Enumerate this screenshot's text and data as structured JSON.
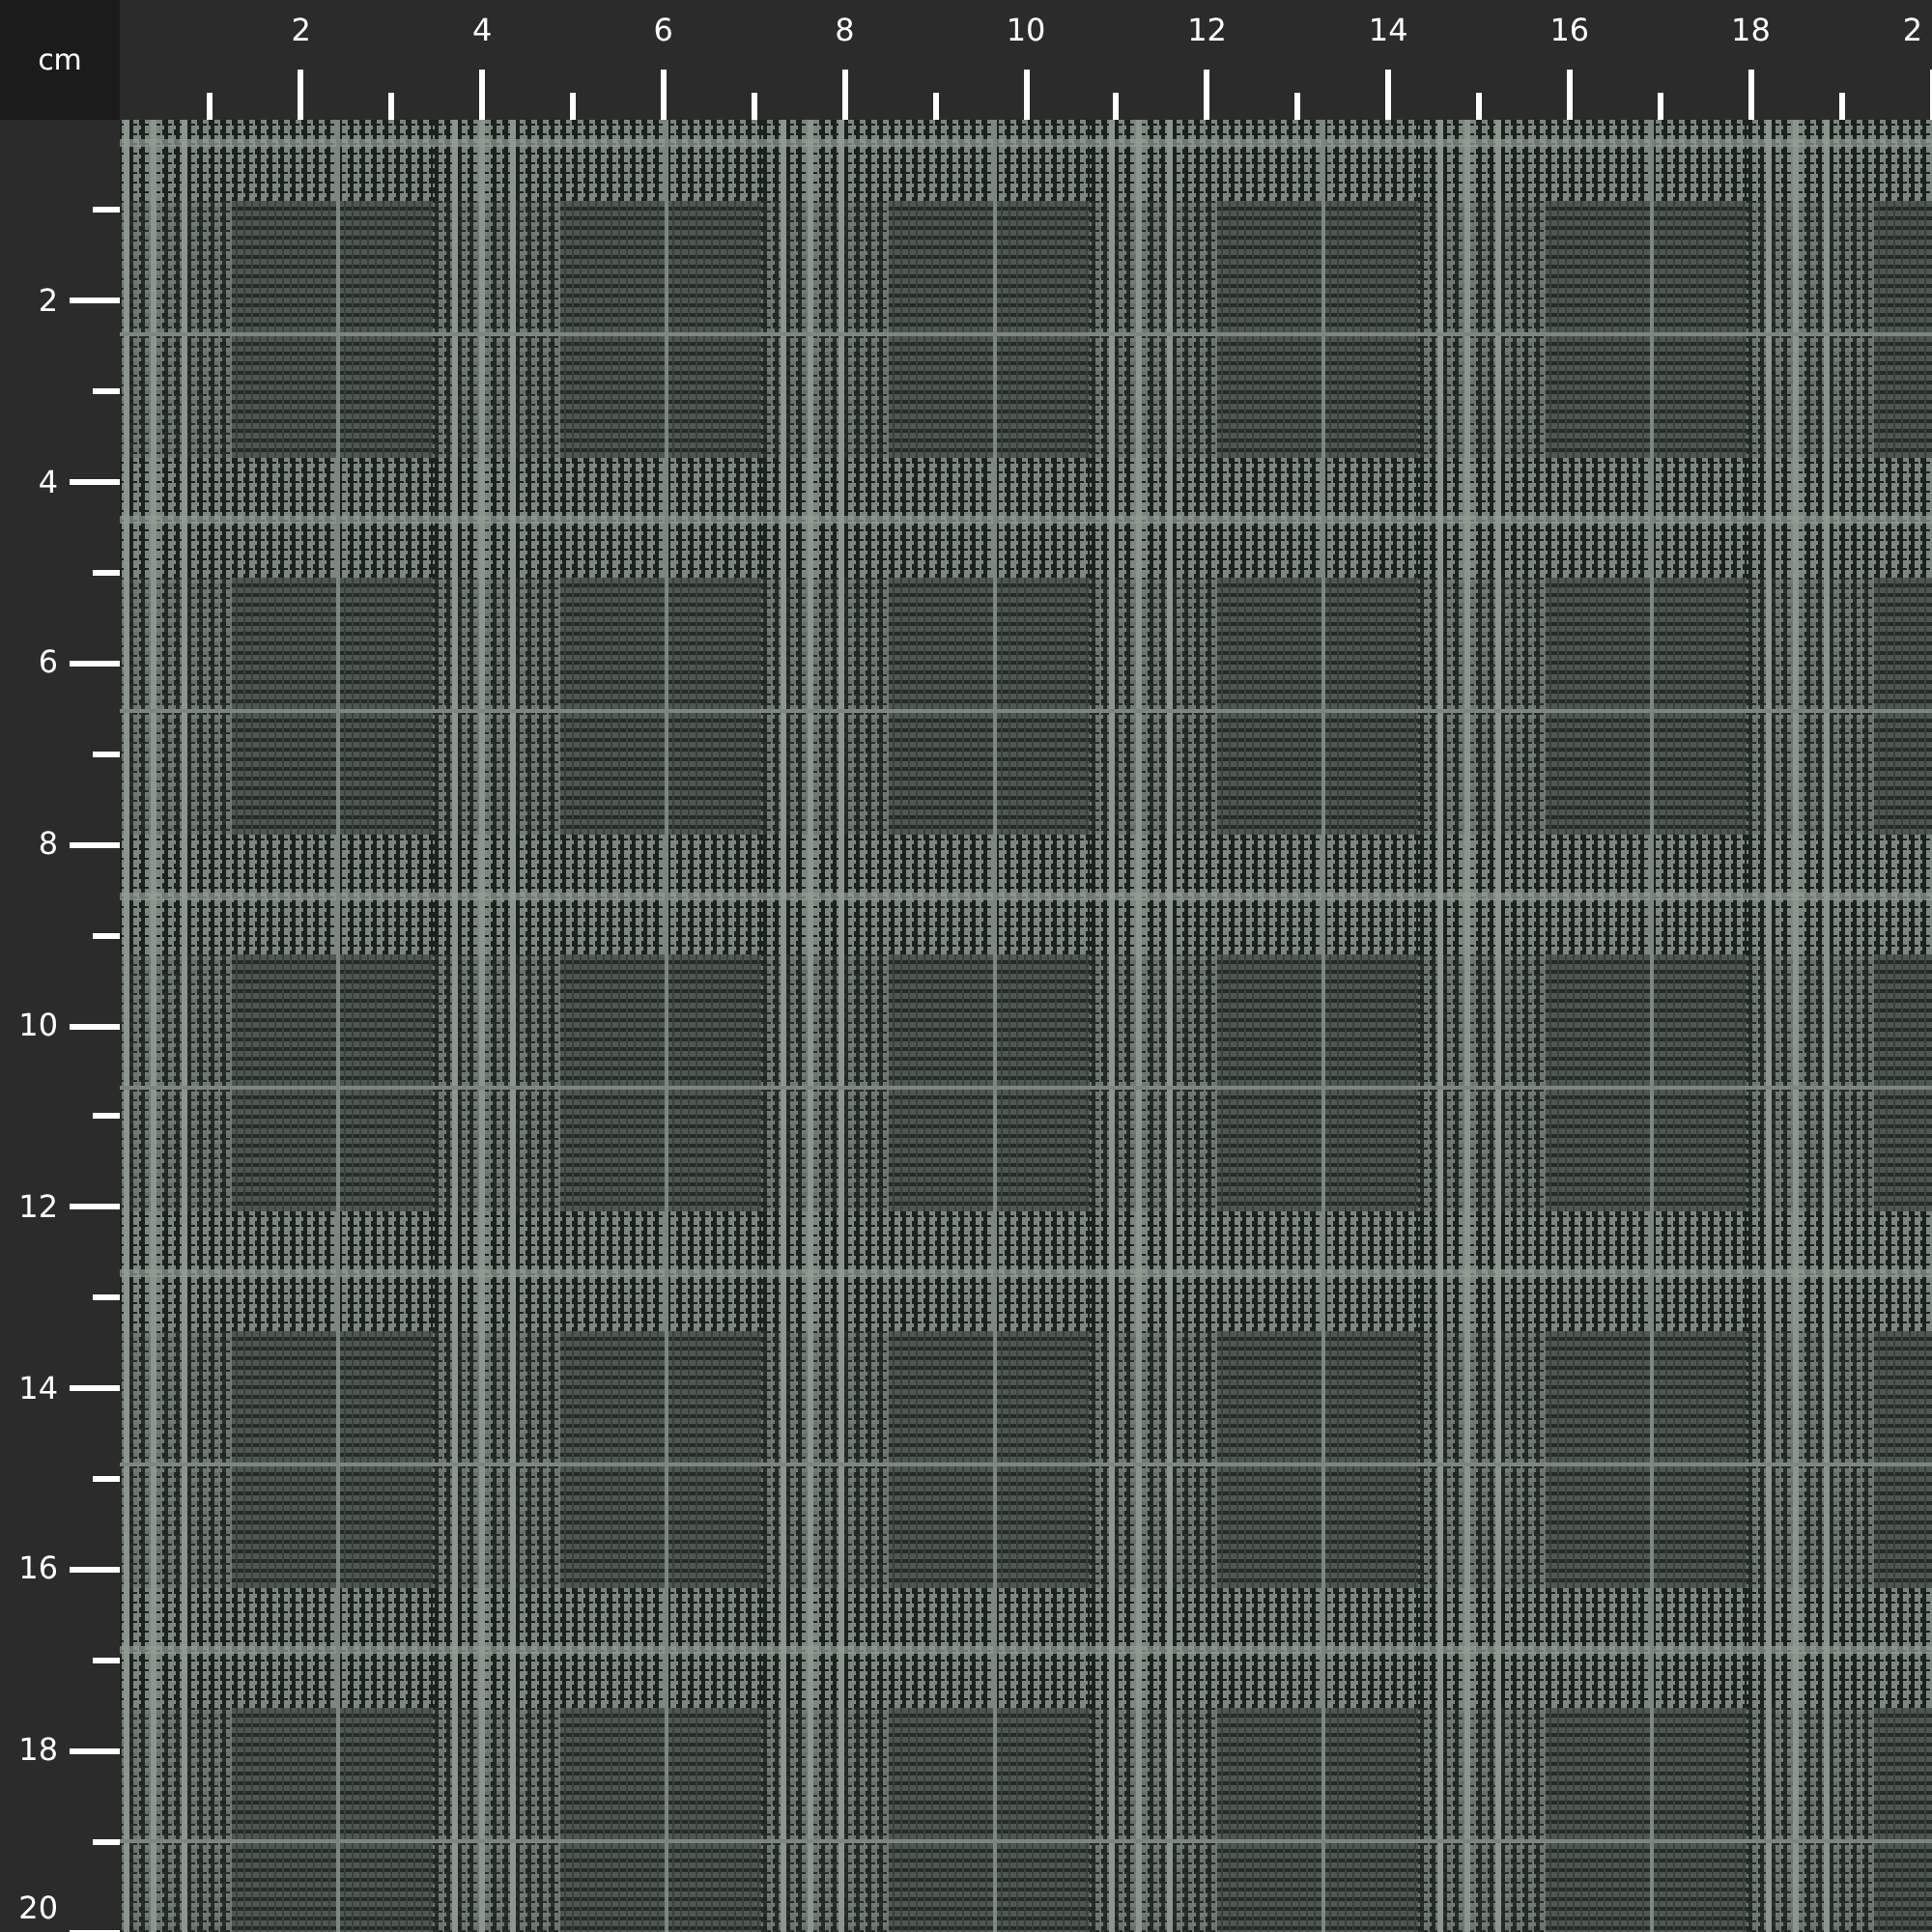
{
  "unit": "cm",
  "top_ruler": {
    "labels": [
      "2",
      "4",
      "6",
      "8",
      "10",
      "12",
      "14",
      "16",
      "18",
      "2"
    ]
  },
  "left_ruler": {
    "labels": [
      "2",
      "4",
      "6",
      "8",
      "10",
      "12",
      "14",
      "16",
      "18",
      "20"
    ]
  }
}
